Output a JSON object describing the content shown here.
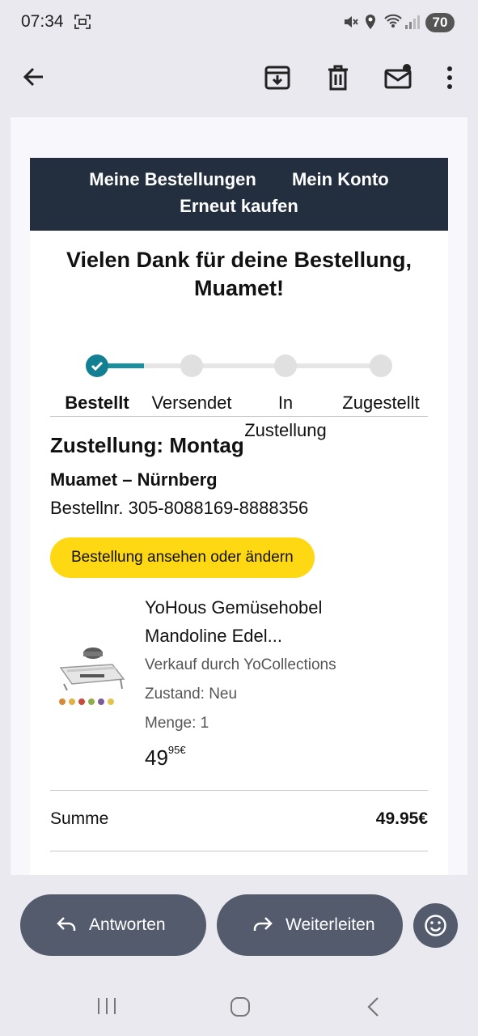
{
  "status_bar": {
    "time": "07:34",
    "battery": "70",
    "icons": [
      "screenshot-icon",
      "mute-icon",
      "location-icon",
      "wifi-icon",
      "signal-icon",
      "battery-icon"
    ]
  },
  "toolbar": {
    "icons": [
      "back-arrow-icon",
      "archive-icon",
      "delete-icon",
      "mark-unread-icon",
      "more-options-icon"
    ]
  },
  "email": {
    "nav": {
      "my_orders": "Meine Bestellungen",
      "my_account": "Mein Konto",
      "buy_again": "Erneut kaufen",
      "background_color": "#232f3e"
    },
    "thanks_line1": "Vielen Dank für deine Bestellung,",
    "thanks_line2": "Muamet!",
    "progress": {
      "steps": [
        "Bestellt",
        "Versendet",
        "In Zustellung",
        "Zugestellt"
      ],
      "step_line1": [
        "Bestellt",
        "Versendet",
        "In",
        "Zugestellt"
      ],
      "step_line2": "Zustellung",
      "current_step": 1,
      "accent_color": "#137f93"
    },
    "delivery": "Zustellung: Montag",
    "address": "Muamet – Nürnberg",
    "order_number": "Bestellnr. 305-8088169-8888356",
    "cta_label": "Bestellung ansehen oder ändern",
    "cta_color": "#ffd814",
    "product": {
      "title_line1": "YoHous Gemüsehobel",
      "title_line2": "Mandoline Edel...",
      "seller": "Verkauf durch YoCollections",
      "condition": "Zustand: Neu",
      "quantity": "Menge: 1",
      "price_main": "49",
      "price_cents": "95€"
    },
    "sum_label": "Summe",
    "sum_value": "49.95€"
  },
  "actions": {
    "reply": "Antworten",
    "forward": "Weiterleiten",
    "button_color": "#535b6c"
  },
  "system_nav": {
    "icons": [
      "recents-icon",
      "home-icon",
      "back-icon"
    ]
  }
}
